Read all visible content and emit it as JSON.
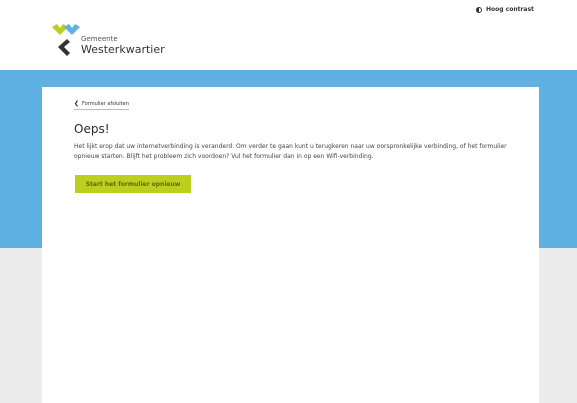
{
  "header": {
    "contrast_label": "Hoog contrast",
    "logo": {
      "small_text": "Gemeente",
      "big_text": "Westerkwartier",
      "colors": {
        "yellow": "#bccf1f",
        "blue": "#5fb0e3",
        "dark": "#333333"
      }
    }
  },
  "main": {
    "back_label": "Formulier afsluiten",
    "title": "Oeps!",
    "message": "Het lijkt erop dat uw internetverbinding is veranderd. Om verder te gaan kunt u terugkeren naar uw oorspronkelijke verbinding, of het formulier opnieuw starten. Blijft het probleem zich voordoen? Vul het formulier dan in op een Wifi-verbinding.",
    "restart_button": "Start het formulier opnieuw"
  },
  "colors": {
    "accent_blue": "#5fb0e3",
    "button_green": "#bccf1f",
    "background_gray": "#ececec"
  }
}
